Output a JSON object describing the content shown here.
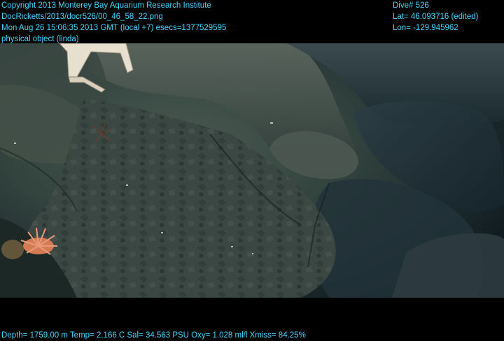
{
  "overlay": {
    "top_left": [
      "Copyright 2013 Monterey Bay Aquarium Research Institute",
      "DocRicketts/2013/docr526/00_46_58_22.png",
      "Mon Aug 26 15:06:35 2013 GMT (local +7)  esecs=1377529595",
      "physical object (linda)"
    ],
    "top_right": [
      "Dive# 526",
      "Lat= 46.093716 (edited)",
      "Lon= -129.945962"
    ],
    "bottom": "Depth= 1759.00 m  Temp= 2.166 C  Sal= 34.563 PSU  Oxy= 1.028 ml/l  Xmiss= 84.25%"
  },
  "colors": {
    "overlay_text": "#3fd7ff",
    "background": "#000000"
  }
}
